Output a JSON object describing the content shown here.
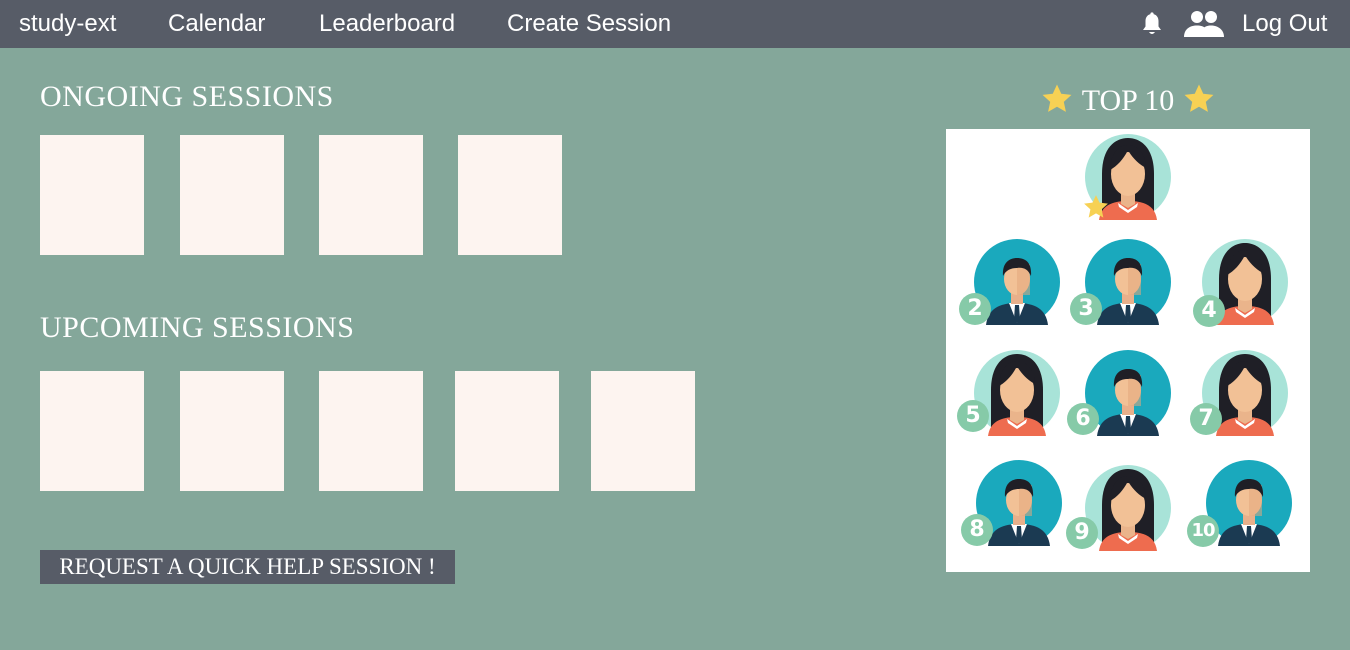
{
  "topbar": {
    "brand": "study-ext",
    "nav": [
      "Calendar",
      "Leaderboard",
      "Create Session"
    ],
    "logout": "Log Out",
    "icons": [
      "bell-icon",
      "people-icon"
    ]
  },
  "ongoing": {
    "title": "ONGOING SESSIONS",
    "card_count": 4
  },
  "upcoming": {
    "title": "UPCOMING SESSIONS",
    "card_count": 5
  },
  "help_button": "REQUEST A QUICK HELP SESSION !",
  "leaderboard": {
    "title": "TOP 10",
    "entries": [
      {
        "rank": "1",
        "avatar": "woman"
      },
      {
        "rank": "2",
        "avatar": "man"
      },
      {
        "rank": "3",
        "avatar": "man"
      },
      {
        "rank": "4",
        "avatar": "woman"
      },
      {
        "rank": "5",
        "avatar": "woman"
      },
      {
        "rank": "6",
        "avatar": "man"
      },
      {
        "rank": "7",
        "avatar": "woman"
      },
      {
        "rank": "8",
        "avatar": "man"
      },
      {
        "rank": "9",
        "avatar": "woman"
      },
      {
        "rank": "10",
        "avatar": "man"
      }
    ]
  },
  "colors": {
    "background": "#84a79a",
    "topbar": "#575c67",
    "card": "#fdf4f0",
    "star": "#f7d154",
    "man_avatar_bg": "#1aa9bd",
    "woman_avatar_bg": "#a8e3d8",
    "rank_badge": "#86caa8"
  }
}
